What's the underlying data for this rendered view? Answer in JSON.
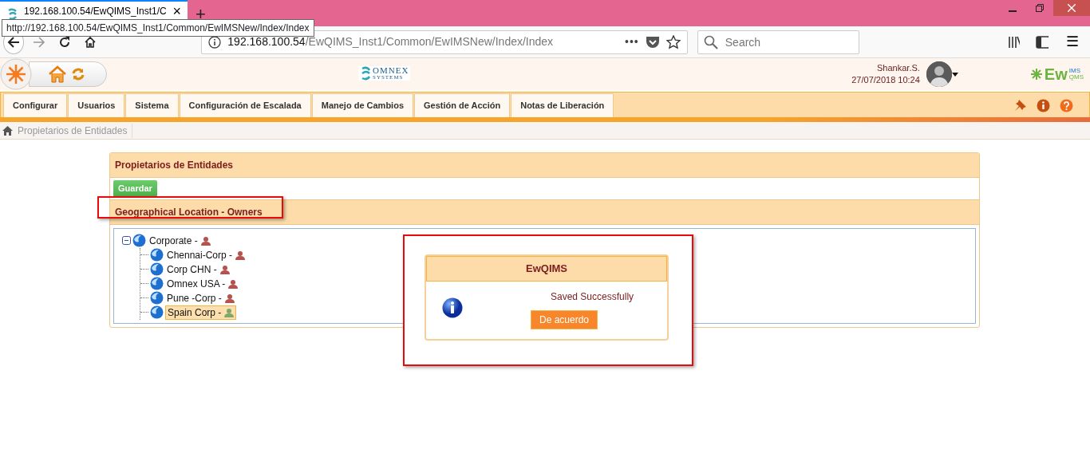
{
  "browser": {
    "tab": {
      "title": "192.168.100.54/EwQIMS_Inst1/C",
      "close": "×"
    },
    "new_tab": "+",
    "tooltip": "http://192.168.100.54/EwQIMS_Inst1/Common/EwIMSNew/Index/Index",
    "url": {
      "host": "192.168.100.54",
      "path": "/EwQIMS_Inst1/Common/EwIMSNew/Index/Index"
    },
    "page_actions": "•••",
    "search": {
      "placeholder": "Search"
    },
    "menu": "☰"
  },
  "app": {
    "logo": {
      "name": "OMNEX",
      "tagline": "SYSTEMS"
    },
    "user": {
      "name": "Shankar.S.",
      "datetime": "27/07/2018 10:24"
    },
    "brand": {
      "main": "Ew",
      "top": "IMS",
      "bottom": "QMS"
    }
  },
  "menu": [
    {
      "label": "Configurar"
    },
    {
      "label": "Usuarios"
    },
    {
      "label": "Sistema"
    },
    {
      "label": "Configuración de Escalada"
    },
    {
      "label": "Manejo de Cambios"
    },
    {
      "label": "Gestión de Acción"
    },
    {
      "label": "Notas de Liberación"
    }
  ],
  "breadcrumb": [
    "Propietarios de Entidades"
  ],
  "panel": {
    "title": "Propietarios de Entidades",
    "save_button": "Guardar",
    "section": {
      "title": "Geographical Location - Owners",
      "highlighted": true
    },
    "tree": [
      {
        "label": "Corporate -",
        "expanded": true,
        "selected": false,
        "children": [
          {
            "label": "Chennai-Corp -",
            "selected": false
          },
          {
            "label": "Corp CHN -",
            "selected": false
          },
          {
            "label": "Omnex USA -",
            "selected": false
          },
          {
            "label": "Pune -Corp -",
            "selected": false
          },
          {
            "label": "Spain Corp -",
            "selected": true
          }
        ]
      }
    ]
  },
  "dialog": {
    "title": "EwQIMS",
    "message": "Saved Successfully",
    "button": "De acuerdo",
    "highlighted": true
  }
}
